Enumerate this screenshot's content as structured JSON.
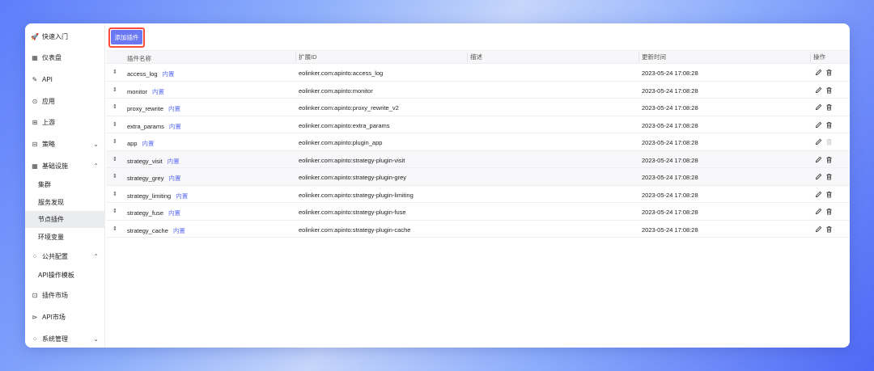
{
  "sidebar": {
    "items": [
      {
        "label": "快速入门",
        "icon": "rocket-icon"
      },
      {
        "label": "仪表盘",
        "icon": "dashboard-icon"
      },
      {
        "label": "API",
        "icon": "api-link-icon"
      },
      {
        "label": "应用",
        "icon": "app-icon"
      },
      {
        "label": "上游",
        "icon": "upstream-icon"
      },
      {
        "label": "策略",
        "icon": "policy-icon"
      },
      {
        "label": "基础设施",
        "icon": "infrastructure-icon"
      },
      {
        "label": "公共配置",
        "icon": "public-config-icon"
      },
      {
        "label": "插件市场",
        "icon": "plugin-market-icon"
      },
      {
        "label": "API市场",
        "icon": "api-market-icon"
      },
      {
        "label": "系统管理",
        "icon": "system-icon"
      }
    ],
    "infra_sub": [
      "集群",
      "服务发现",
      "节点插件",
      "环境变量"
    ],
    "public_sub": [
      "API操作模板"
    ]
  },
  "toolbar": {
    "add_label": "添加插件"
  },
  "table": {
    "headers": {
      "name": "插件名称",
      "ext_id": "扩展ID",
      "desc": "描述",
      "updated": "更新时间",
      "ops": "操作"
    },
    "builtin_label": "内置",
    "rows": [
      {
        "name": "access_log",
        "ext_id": "eolinker.com:apinto:access_log",
        "desc": "",
        "updated": "2023-05-24 17:08:28"
      },
      {
        "name": "monitor",
        "ext_id": "eolinker.com:apinto:monitor",
        "desc": "",
        "updated": "2023-05-24 17:08:28"
      },
      {
        "name": "proxy_rewrite",
        "ext_id": "eolinker.com:apinto:proxy_rewrite_v2",
        "desc": "",
        "updated": "2023-05-24 17:08:28"
      },
      {
        "name": "extra_params",
        "ext_id": "eolinker.com:apinto:extra_params",
        "desc": "",
        "updated": "2023-05-24 17:08:28"
      },
      {
        "name": "app",
        "ext_id": "eolinker.com:apinto:plugin_app",
        "desc": "",
        "updated": "2023-05-24 17:08:28"
      },
      {
        "name": "strategy_visit",
        "ext_id": "eolinker.com:apinto:strategy-plugin-visit",
        "desc": "",
        "updated": "2023-05-24 17:08:28"
      },
      {
        "name": "strategy_grey",
        "ext_id": "eolinker.com:apinto:strategy-plugin-grey",
        "desc": "",
        "updated": "2023-05-24 17:08:28"
      },
      {
        "name": "strategy_limiting",
        "ext_id": "eolinker.com:apinto:strategy-plugin-limiting",
        "desc": "",
        "updated": "2023-05-24 17:08:28"
      },
      {
        "name": "strategy_fuse",
        "ext_id": "eolinker.com:apinto:strategy-plugin-fuse",
        "desc": "",
        "updated": "2023-05-24 17:08:28"
      },
      {
        "name": "strategy_cache",
        "ext_id": "eolinker.com:apinto:strategy-plugin-cache",
        "desc": "",
        "updated": "2023-05-24 17:08:28"
      }
    ]
  },
  "colors": {
    "accent": "#6a78f4",
    "highlight": "#ff4d3d",
    "builtin": "#5b6cf0"
  }
}
